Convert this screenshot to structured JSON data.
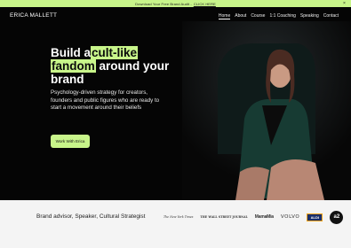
{
  "announcement": {
    "text": "Download Your Free Brand Audit - ",
    "link": "CLICK HERE",
    "close": "×"
  },
  "nav": {
    "logo": "ERICA MALLETT",
    "items": [
      {
        "label": "Home",
        "active": true
      },
      {
        "label": "About"
      },
      {
        "label": "Course"
      },
      {
        "label": "1:1 Coaching"
      },
      {
        "label": "Speaking"
      },
      {
        "label": "Contact"
      }
    ]
  },
  "hero": {
    "headline_pre": "Build a",
    "headline_hl1": "cult-like",
    "headline_hl2": "fandom",
    "headline_post": " around your brand",
    "subcopy": "Psychology-driven strategy for creators, founders and public figures who are ready to start a movement around their beliefs",
    "cta": "Work With Erica"
  },
  "featured": {
    "tagline": "Brand advisor, Speaker, Cultural Strategist",
    "logos": [
      "The New York Times",
      "THE WALL STREET JOURNAL",
      "MamaMia",
      "VOLVO",
      "ALDI",
      "a2"
    ]
  },
  "colors": {
    "accent": "#c8f58a",
    "hero_bg": "#050505",
    "strip_bg": "#f4f4f4"
  }
}
